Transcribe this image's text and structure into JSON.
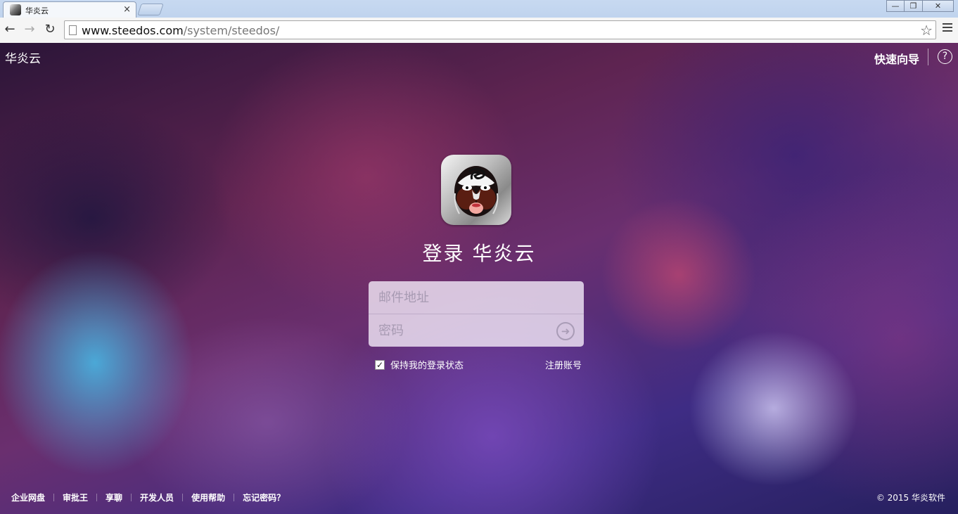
{
  "browser": {
    "tab_title": "华炎云",
    "tab_close": "×",
    "window_buttons": [
      "—",
      "❐",
      "✕"
    ],
    "url_host": "www.steedos.com",
    "url_path": "/system/steedos/"
  },
  "header": {
    "brand": "华炎云",
    "guide_label": "快速向导",
    "help_glyph": "?"
  },
  "login": {
    "title": "登录 华炎云",
    "email_placeholder": "邮件地址",
    "password_placeholder": "密码",
    "submit_glyph": "➜",
    "remember_label": "保持我的登录状态",
    "remember_checked": true,
    "register_label": "注册账号"
  },
  "footer": {
    "links": [
      "企业网盘",
      "审批王",
      "享聊",
      "开发人员",
      "使用帮助",
      "忘记密码？"
    ],
    "copyright": "© 2015 华炎软件"
  }
}
